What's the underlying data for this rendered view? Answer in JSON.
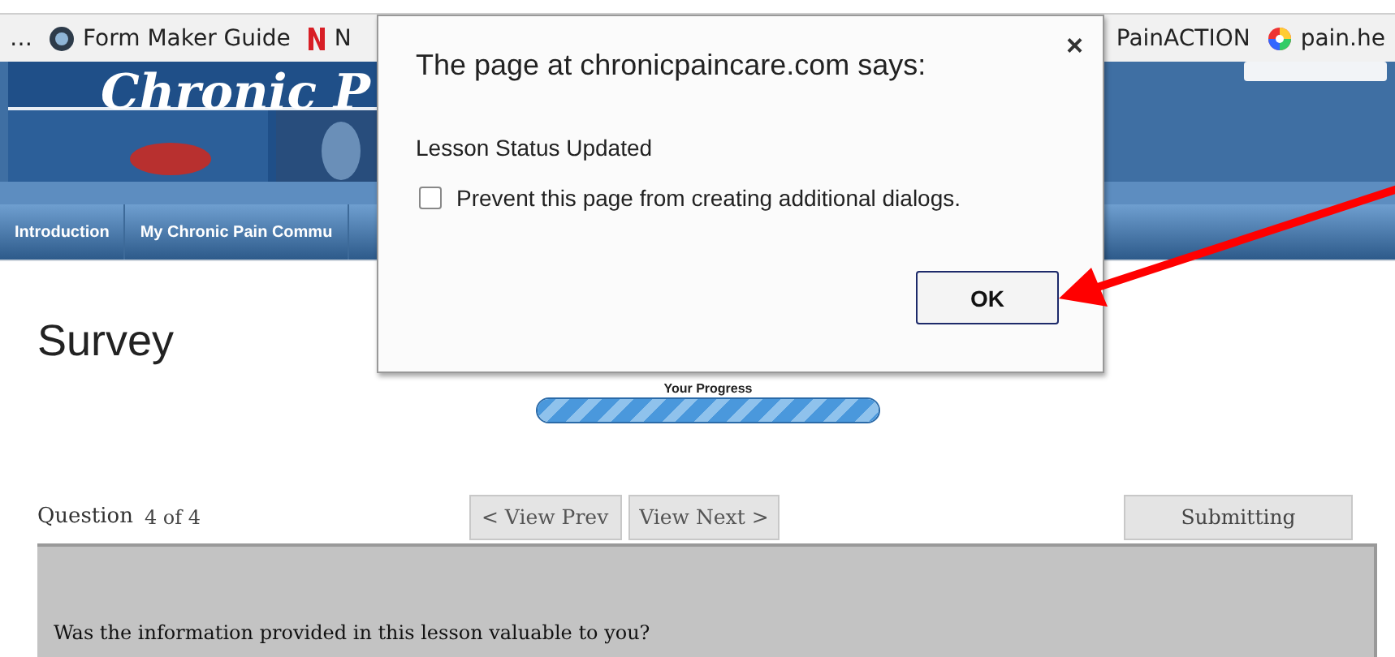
{
  "bookmarks": [
    {
      "label": "…",
      "kind": "more"
    },
    {
      "label": "Form Maker Guide",
      "kind": "globe"
    },
    {
      "label": "N",
      "kind": "netflix"
    }
  ],
  "bookmarks_right": [
    {
      "label": "PainACTION",
      "kind": "none"
    },
    {
      "label": "pain.he",
      "kind": "wheel"
    }
  ],
  "banner": {
    "logo": "Chronic P"
  },
  "nav": [
    {
      "label": "Introduction"
    },
    {
      "label": "My Chronic Pain Commu"
    }
  ],
  "page": {
    "title": "Survey",
    "progress_label": "Your Progress",
    "progress": {
      "level": 1
    },
    "question_label": "Question",
    "question_count": "4 of 4",
    "prev": "< View Prev",
    "next": "View Next >",
    "submit": "Submitting",
    "question": "Was the information provided in this lesson valuable to you?"
  },
  "dialog": {
    "title": "The page at chronicpaincare.com says:",
    "close": "×",
    "message": "Lesson Status Updated",
    "checkbox": {
      "label": "Prevent this page from creating additional dialogs.",
      "checked": false
    },
    "ok": "OK"
  }
}
